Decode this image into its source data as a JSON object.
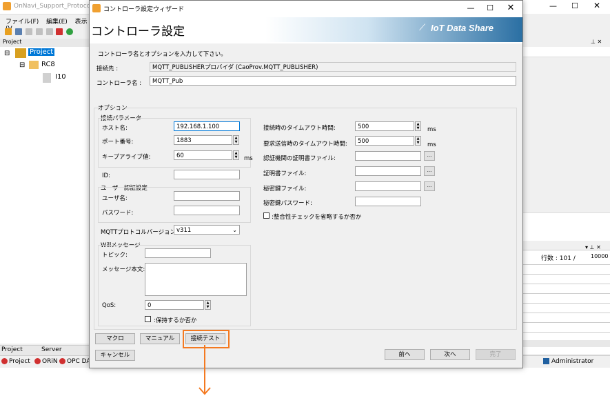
{
  "background_app": {
    "title": "OnNavi_Support_Protocol_M",
    "menu": [
      "ファイル(F)",
      "編集(E)",
      "表示(V"
    ],
    "project_panel_title": "Project",
    "tree": [
      {
        "label": "Project"
      },
      {
        "label": "RC8"
      },
      {
        "label": "I10"
      }
    ],
    "bottom_tabs": [
      "Project",
      "Server"
    ],
    "status_items": [
      "Project",
      "ORiN",
      "OPC DA"
    ],
    "status_user": "Administrator",
    "right_panel": {
      "rows_label": "行数 : 101 /",
      "rows_total": "10000"
    }
  },
  "dialog": {
    "window_title": "コントローラ設定ウィザード",
    "header_title": "コントローラ設定",
    "brand": "IoT Data Share",
    "instruction": "コントローラ名とオプションを入力して下さい。",
    "provider_label": "接続先 :",
    "provider_value": "MQTT_PUBLISHERプロバイダ (CaoProv.MQTT_PUBLISHER)",
    "controller_label": "コントローラ名 :",
    "controller_value": "MQTT_Pub",
    "options_group": "オプション",
    "conn_params_group": "接続パラメータ",
    "host_label": "ホスト名:",
    "host_value": "192.168.1.100",
    "port_label": "ポート番号:",
    "port_value": "1883",
    "keepalive_label": "キープアライブ値:",
    "keepalive_value": "60",
    "ms_unit": "ms",
    "id_label": "ID:",
    "id_value": "",
    "auth_group": "ユーザー認証設定",
    "user_label": "ユーザ名:",
    "user_value": "",
    "password_label": "パスワード:",
    "password_value": "",
    "mqtt_version_label": "MQTTプロトコルバージョン:",
    "mqtt_version_value": "v311",
    "will_group": "Willメッセージ",
    "topic_label": "トピック:",
    "topic_value": "",
    "message_label": "メッセージ本文:",
    "message_value": "",
    "qos_label": "QoS:",
    "qos_value": "0",
    "retain_label": ":保持するか否か",
    "conn_timeout_label": "接続時のタイムアウト時間:",
    "conn_timeout_value": "500",
    "req_timeout_label": "要求送信時のタイムアウト時間:",
    "req_timeout_value": "500",
    "ca_cert_label": "認証機関の証明書ファイル:",
    "cert_label": "証明書ファイル:",
    "key_label": "秘密鍵ファイル:",
    "key_pass_label": "秘密鍵パスワード:",
    "browse_label": "...",
    "skip_check_label": ":整合性チェックを省略するか否か",
    "macro_button": "マクロ",
    "manual_button": "マニュアル",
    "test_button": "接続テスト",
    "cancel_button": "キャンセル",
    "back_button": "前へ",
    "next_button": "次へ",
    "finish_button": "完了"
  },
  "colors": {
    "highlight": "#f47920",
    "selection": "#0078d7",
    "brand_gradient_end": "#2a6fa3"
  }
}
